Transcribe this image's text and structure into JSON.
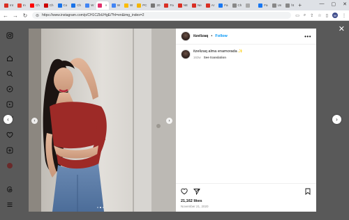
{
  "browser": {
    "tabs": [
      {
        "label": "M",
        "title": "Int",
        "color": "#d93025"
      },
      {
        "label": "",
        "title": "In",
        "color": "#ea4335"
      },
      {
        "label": "",
        "title": "Ch",
        "color": "#ff0000"
      },
      {
        "label": "",
        "title": "Ch",
        "color": "#cc0000"
      },
      {
        "label": "",
        "title": "Co",
        "color": "#1a73e8"
      },
      {
        "label": "",
        "title": "Ch",
        "color": "#1a73e8"
      },
      {
        "label": "",
        "title": "W",
        "color": "#4285f4"
      },
      {
        "label": "",
        "title": "",
        "color": "#e1306c",
        "active": true
      },
      {
        "label": "",
        "title": "W",
        "color": "#4285f4"
      },
      {
        "label": "",
        "title": "W",
        "color": "#fbbc05"
      },
      {
        "label": "",
        "title": "PC",
        "color": "#f4b400"
      },
      {
        "label": "",
        "title": "20",
        "color": "#777"
      },
      {
        "label": "",
        "title": "Fa",
        "color": "#d93025"
      },
      {
        "label": "",
        "title": "NE",
        "color": "#d93025"
      },
      {
        "label": "",
        "title": "Ne",
        "color": "#d93025"
      },
      {
        "label": "",
        "title": "Ar",
        "color": "#d93025"
      },
      {
        "label": "",
        "title": "Fa",
        "color": "#1877f2"
      },
      {
        "label": "",
        "title": "Ch",
        "color": "#888"
      },
      {
        "label": "",
        "title": "",
        "color": "#aaa"
      },
      {
        "label": "",
        "title": "Fa",
        "color": "#1877f2"
      },
      {
        "label": "",
        "title": "Un",
        "color": "#888"
      },
      {
        "label": "",
        "title": "ht",
        "color": "#888"
      }
    ],
    "url": "https://www.instagram.com/p/CH1CZbUHgE/?hl=en&img_index=2",
    "profile_initial": "M"
  },
  "post": {
    "username": "itzelizaq",
    "separator": "•",
    "follow_label": "Follow",
    "more_label": "•••",
    "caption": "itzelizaq alma enamorada ✨",
    "age": "163w",
    "see_translation": "See translation",
    "likes": "21,162 likes",
    "date": "November 21, 2020",
    "carousel_dots": 3,
    "carousel_active": 1
  },
  "icons": {
    "close": "close-icon",
    "prev": "chevron-left-icon",
    "next": "chevron-right-icon"
  }
}
